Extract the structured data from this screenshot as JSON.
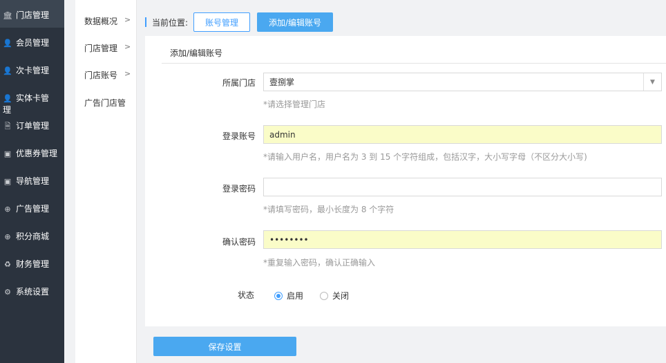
{
  "sidebar": {
    "items": [
      {
        "label": "门店管理",
        "icon": "bank-icon",
        "glyph": "🏛"
      },
      {
        "label": "会员管理",
        "icon": "user-icon",
        "glyph": "👤"
      },
      {
        "label": "次卡管理",
        "icon": "user-icon",
        "glyph": "👤"
      },
      {
        "label": "实体卡管理",
        "icon": "user-icon",
        "glyph": "👤"
      },
      {
        "label": "订单管理",
        "icon": "document-icon",
        "glyph": "🗎"
      },
      {
        "label": "优惠券管理",
        "icon": "money-icon",
        "glyph": "▣"
      },
      {
        "label": "导航管理",
        "icon": "money-icon",
        "glyph": "▣"
      },
      {
        "label": "广告管理",
        "icon": "lifebuoy-icon",
        "glyph": "⊕"
      },
      {
        "label": "积分商城",
        "icon": "lifebuoy-icon",
        "glyph": "⊕"
      },
      {
        "label": "财务管理",
        "icon": "recycle-icon",
        "glyph": "♻"
      },
      {
        "label": "系统设置",
        "icon": "gear-icon",
        "glyph": "⚙"
      }
    ]
  },
  "subnav": {
    "items": [
      {
        "label": "数据概况",
        "chevron": ">"
      },
      {
        "label": "门店管理",
        "chevron": ">"
      },
      {
        "label": "门店账号",
        "chevron": ">"
      },
      {
        "label": "广告门店管"
      }
    ]
  },
  "breadcrumb": {
    "label": "当前位置:",
    "link": "账号管理",
    "current": "添加/编辑账号"
  },
  "form": {
    "title": "添加/编辑账号",
    "store": {
      "label": "所属门店",
      "value": "壹捌掌",
      "hint": "*请选择管理门店"
    },
    "account": {
      "label": "登录账号",
      "value": "admin",
      "hint": "*请输入用户名，用户名为 3 到 15 个字符组成，包括汉字，大小写字母（不区分大小写)"
    },
    "password": {
      "label": "登录密码",
      "value": "",
      "hint": "*请填写密码，最小长度为 8 个字符"
    },
    "confirm": {
      "label": "确认密码",
      "value": "••••••••",
      "hint": "*重复输入密码，确认正确输入"
    },
    "status": {
      "label": "状态",
      "on_label": "启用",
      "off_label": "关闭",
      "selected": "启用"
    },
    "save_label": "保存设置"
  },
  "colors": {
    "accent": "#409eff",
    "sidebar_bg": "#2b333e",
    "autofill": "#fafcc8"
  }
}
